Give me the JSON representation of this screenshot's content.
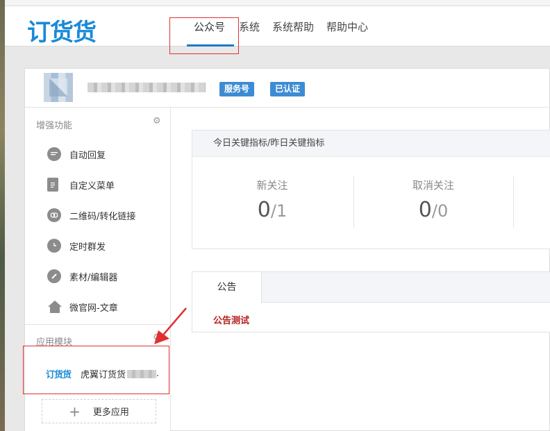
{
  "header": {
    "logo_text": "订货货",
    "nav": [
      {
        "label": "公众号",
        "active": true
      },
      {
        "label": "系统"
      },
      {
        "label": "系统帮助"
      },
      {
        "label": "帮助中心"
      }
    ]
  },
  "account": {
    "badges": [
      "服务号",
      "已认证"
    ]
  },
  "sidebar": {
    "enhanced_title": "增强功能",
    "enhanced_items": [
      {
        "label": "自动回复",
        "icon": "chat-bubble-icon"
      },
      {
        "label": "自定义菜单",
        "icon": "document-edit-icon"
      },
      {
        "label": "二维码/转化链接",
        "icon": "link-icon"
      },
      {
        "label": "定时群发",
        "icon": "clock-icon"
      },
      {
        "label": "素材/编辑器",
        "icon": "pencil-icon"
      },
      {
        "label": "微官网-文章",
        "icon": "home-icon"
      }
    ],
    "apps_title": "应用模块",
    "app": {
      "logo_text": "订货货",
      "label": "虎翼订货货"
    },
    "more_apps_label": "更多应用"
  },
  "kpi": {
    "header": "今日关键指标/昨日关键指标",
    "items": [
      {
        "label": "新关注",
        "today": "0",
        "yesterday": "1"
      },
      {
        "label": "取消关注",
        "today": "0",
        "yesterday": "0"
      }
    ],
    "separator": "/"
  },
  "notice": {
    "tab_label": "公告",
    "link_text": "公告测试"
  },
  "colors": {
    "brand": "#1a8ad8",
    "badge": "#3d8cd3",
    "nav_underline": "#1a7cc7",
    "annotation": "#e03030",
    "notice_link": "#b52020"
  }
}
